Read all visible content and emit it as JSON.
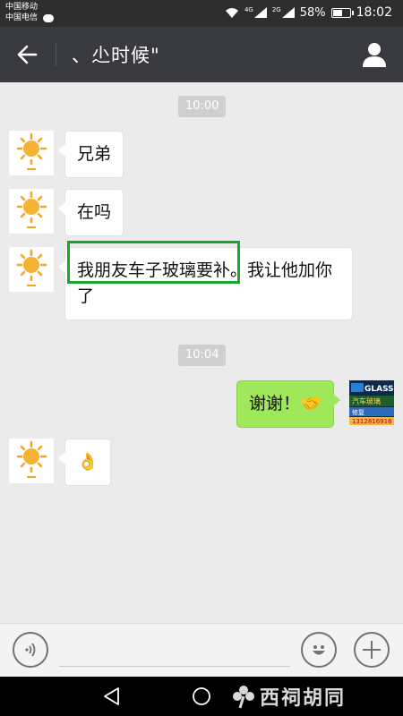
{
  "status_bar": {
    "carrier_1": "中国移动",
    "carrier_2": "中国电信",
    "net_1": "4G",
    "net_2": "2G",
    "battery_pct": "58%",
    "battery_level": 0.58,
    "time": "18:02"
  },
  "header": {
    "title": "、尐时候\"",
    "back_icon": "arrow-left-icon",
    "profile_icon": "person-icon"
  },
  "messages": {
    "ts1": "10:00",
    "m1": "兄弟",
    "m2": "在吗",
    "m3_highlighted": "我朋友车子玻璃要补",
    "m3_rest": "。我让他加你了",
    "ts2": "10:04",
    "m4": "谢谢！🤝",
    "m5": "👌"
  },
  "my_avatar": {
    "brand_text": "GLASS",
    "line_1": "汽车玻璃",
    "line_2": "修复",
    "phone": "1312816916"
  },
  "input_bar": {
    "voice_icon": "voice-icon",
    "emoji_icon": "emoji-icon",
    "plus_icon": "plus-icon",
    "placeholder": ""
  },
  "nav_bar": {
    "back_icon": "triangle-back-icon",
    "home_icon": "circle-home-icon",
    "watermark": "西祠胡同"
  },
  "colors": {
    "header": "#393a3f",
    "status": "#2e2e2e",
    "background": "#ebebeb",
    "sent_bubble": "#a0e75a",
    "highlight": "#1aa52c"
  }
}
